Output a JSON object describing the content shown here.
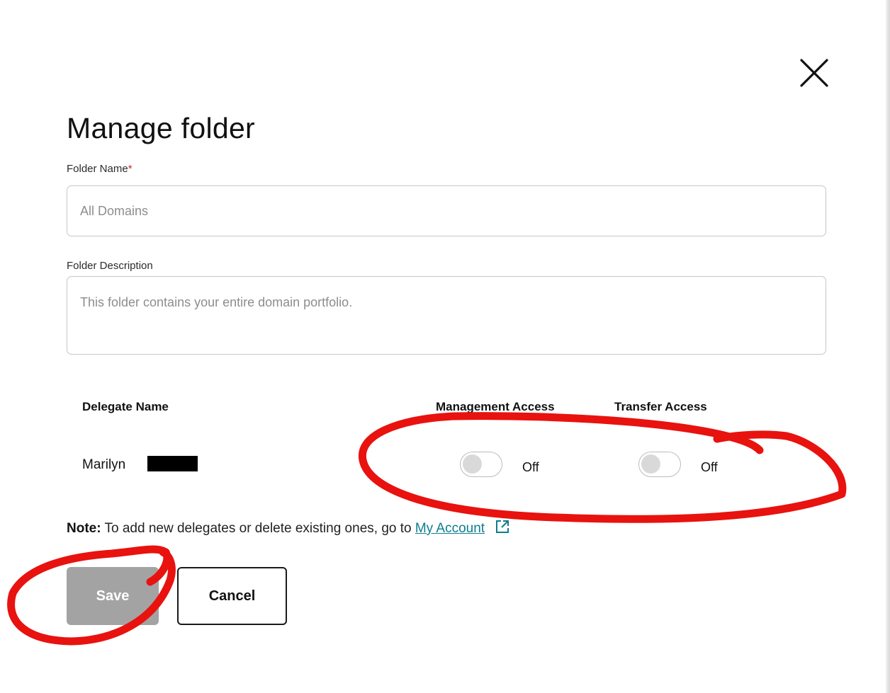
{
  "dialog": {
    "title": "Manage folder",
    "close_icon": "close-icon"
  },
  "form": {
    "folder_name_label": "Folder Name",
    "required_marker": "*",
    "folder_name_placeholder": "All Domains",
    "folder_description_label": "Folder Description",
    "folder_description_placeholder": "This folder contains your entire domain portfolio."
  },
  "delegates": {
    "headers": {
      "name": "Delegate Name",
      "management": "Management Access",
      "transfer": "Transfer Access"
    },
    "rows": [
      {
        "name": "Marilyn",
        "management_state": "Off",
        "transfer_state": "Off"
      }
    ]
  },
  "note": {
    "prefix": "Note:",
    "text": " To add new delegates or delete existing ones, go to ",
    "link": "My Account",
    "link_icon": "external-link-icon"
  },
  "buttons": {
    "save": "Save",
    "cancel": "Cancel"
  },
  "colors": {
    "annotation_red": "#e8120f",
    "save_disabled": "#a3a3a3",
    "link": "#0d7d8f"
  }
}
